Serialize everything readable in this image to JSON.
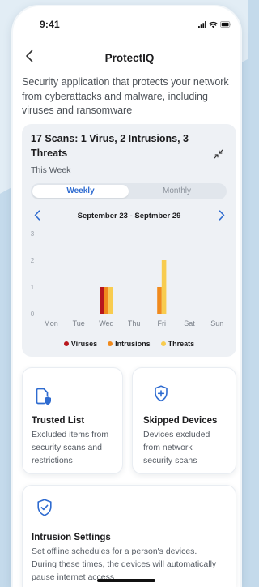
{
  "status_bar": {
    "time": "9:41",
    "icons": [
      "cellular-signal-icon",
      "wifi-icon",
      "battery-icon"
    ]
  },
  "header": {
    "back_icon": "chevron-left-icon",
    "title": "ProtectIQ"
  },
  "description": "Security application that protects your network from cyberattacks and malware, including viruses and ransomware",
  "summary": {
    "heading": "17 Scans: 1 Virus, 2 Intrusions, 3 Threats",
    "collapse_icon": "collapse-arrows-icon",
    "period_label": "This Week",
    "tabs": [
      {
        "label": "Weekly",
        "selected": true
      },
      {
        "label": "Monthly",
        "selected": false
      }
    ],
    "prev_icon": "chevron-left-icon",
    "date_range": "September 23 - Septmber 29",
    "next_icon": "chevron-right-icon"
  },
  "chart_data": {
    "type": "bar",
    "categories": [
      "Mon",
      "Tue",
      "Wed",
      "Thu",
      "Fri",
      "Sat",
      "Sun"
    ],
    "series": [
      {
        "name": "Viruses",
        "color": "#b8171d",
        "values": [
          0,
          0,
          1,
          0,
          0,
          0,
          0
        ]
      },
      {
        "name": "Intrusions",
        "color": "#f08a1d",
        "values": [
          0,
          0,
          1,
          0,
          1,
          0,
          0
        ]
      },
      {
        "name": "Threats",
        "color": "#f8cc4f",
        "values": [
          0,
          0,
          1,
          0,
          2,
          0,
          0
        ]
      }
    ],
    "ylim": [
      0,
      3
    ],
    "yticks": [
      0,
      1,
      2,
      3
    ],
    "grid": false,
    "legend": "bottom"
  },
  "cards": [
    {
      "icon": "document-shield-icon",
      "title": "Trusted List",
      "description": "Excluded items from security scans and restrictions"
    },
    {
      "icon": "shield-plus-icon",
      "title": "Skipped Devices",
      "description": "Devices excluded from network security scans"
    },
    {
      "icon": "shield-check-icon",
      "title": "Intrusion Settings",
      "description": "Set offline schedules for a person's devices. During these times, the devices will automatically pause internet access"
    }
  ],
  "colors": {
    "accent": "#2e6bd0",
    "card_background": "#eef1f5",
    "text": "#1c1c1e",
    "muted_text": "#555b63"
  }
}
